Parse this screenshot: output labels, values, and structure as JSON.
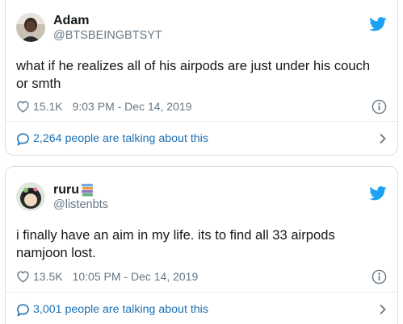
{
  "tweets": [
    {
      "name": "Adam",
      "handle": "@BTSBEINGBTSYT",
      "text": "what if he realizes all of his airpods are just under his couch or smth",
      "likes": "15.1K",
      "timestamp": "9:03 PM - Dec 14, 2019",
      "conversation": "2,264 people are talking about this"
    },
    {
      "name": "ruru",
      "name_emoji": "books-emoji",
      "handle": "@listenbts",
      "text": "i finally have an aim in my life. its to find all 33 airpods namjoon lost.",
      "likes": "13.5K",
      "timestamp": "10:05 PM - Dec 14, 2019",
      "conversation": "3,001 people are talking about this"
    }
  ],
  "icons": [
    "twitter-bird-icon",
    "heart-icon",
    "info-icon",
    "comment-bubble-icon",
    "chevron-right-icon"
  ],
  "colors": {
    "twitter_blue": "#1da1f2",
    "link_blue": "#1b6fb3",
    "text": "#14171a",
    "secondary_text": "#657786",
    "border": "#d5dde3"
  }
}
